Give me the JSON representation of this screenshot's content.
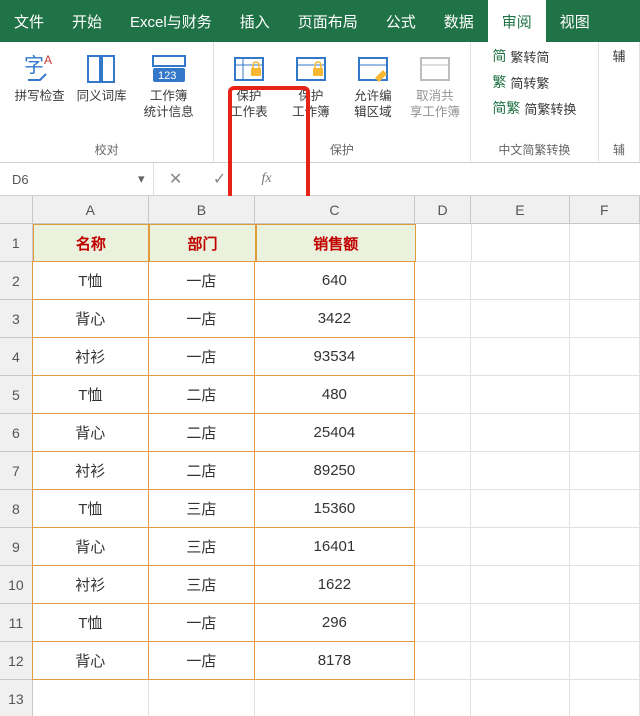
{
  "tabs": [
    "文件",
    "开始",
    "Excel与财务",
    "插入",
    "页面布局",
    "公式",
    "数据",
    "审阅",
    "视图"
  ],
  "active_tab": "审阅",
  "ribbon": {
    "group_proof": "校对",
    "group_protect": "保护",
    "group_cn": "中文简繁转换",
    "group_misc": "辅",
    "spellcheck": "拼写检查",
    "thesaurus": "同义词库",
    "stats": "工作簿\n统计信息",
    "protect_sheet": "保护\n工作表",
    "protect_book": "保护\n工作簿",
    "allow_edit": "允许编\n辑区域",
    "unshare": "取消共\n享工作簿",
    "simp2trad": "繁转简",
    "trad2simp": "简转繁",
    "cn_convert": "简繁转换",
    "misc_item": "辅"
  },
  "namebox": {
    "cell": "D6",
    "fx_label": "fx"
  },
  "columns": [
    "A",
    "B",
    "C",
    "D",
    "E",
    "F"
  ],
  "headers": {
    "a": "名称",
    "b": "部门",
    "c": "销售额"
  },
  "data_rows": [
    {
      "a": "T恤",
      "b": "一店",
      "c": "640"
    },
    {
      "a": "背心",
      "b": "一店",
      "c": "3422"
    },
    {
      "a": "衬衫",
      "b": "一店",
      "c": "93534"
    },
    {
      "a": "T恤",
      "b": "二店",
      "c": "480"
    },
    {
      "a": "背心",
      "b": "二店",
      "c": "25404"
    },
    {
      "a": "衬衫",
      "b": "二店",
      "c": "89250"
    },
    {
      "a": "T恤",
      "b": "三店",
      "c": "15360"
    },
    {
      "a": "背心",
      "b": "三店",
      "c": "16401"
    },
    {
      "a": "衬衫",
      "b": "三店",
      "c": "1622"
    },
    {
      "a": "T恤",
      "b": "一店",
      "c": "296"
    },
    {
      "a": "背心",
      "b": "一店",
      "c": "8178"
    }
  ]
}
